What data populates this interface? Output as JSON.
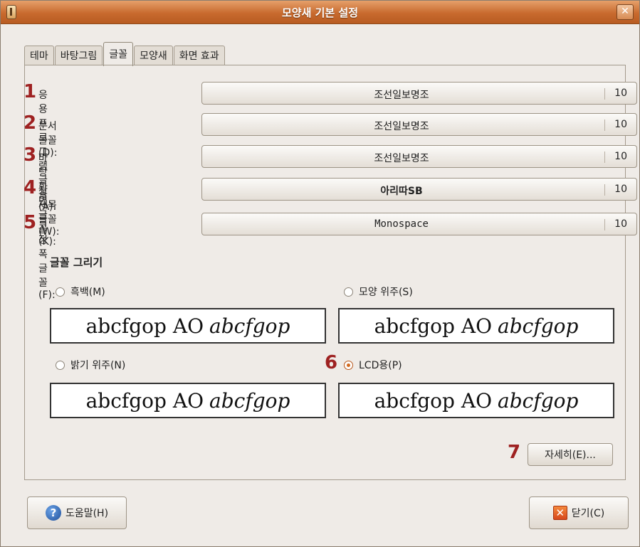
{
  "window": {
    "title": "모양새 기본 설정",
    "close_glyph": "✕"
  },
  "tabs": [
    {
      "label": "테마",
      "active": false
    },
    {
      "label": "바탕그림",
      "active": false
    },
    {
      "label": "글꼴",
      "active": true
    },
    {
      "label": "모양새",
      "active": false
    },
    {
      "label": "화면 효과",
      "active": false
    }
  ],
  "font_rows": [
    {
      "marker": "1",
      "label": "응용프로그램 글꼴(A):",
      "font": "조선일보명조",
      "size": "10"
    },
    {
      "marker": "2",
      "label": "문서 글꼴(D):",
      "font": "조선일보명조",
      "size": "10"
    },
    {
      "marker": "3",
      "label": "바탕 화면 글꼴(K):",
      "font": "조선일보명조",
      "size": "10"
    },
    {
      "marker": "4",
      "label": "창 제목 글꼴(W):",
      "font": "아리따SB",
      "size": "10"
    },
    {
      "marker": "5",
      "label": "고정폭 글꼴(F):",
      "font": "Monospace",
      "size": "10"
    }
  ],
  "rendering": {
    "title": "글꼴 그리기",
    "options": [
      {
        "label": "흑백(M)",
        "selected": false
      },
      {
        "label": "모양 위주(S)",
        "selected": false
      },
      {
        "label": "밝기 위주(N)",
        "selected": false
      },
      {
        "label": "LCD용(P)",
        "selected": true,
        "marker": "6"
      }
    ],
    "sample_regular": "abcfgop AO",
    "sample_italic": "abcfgop"
  },
  "details_button": {
    "marker": "7",
    "label": "자세히(E)..."
  },
  "footer": {
    "help_label": "도움말(H)",
    "close_label": "닫기(C)",
    "help_glyph": "?",
    "close_glyph": "✕"
  }
}
